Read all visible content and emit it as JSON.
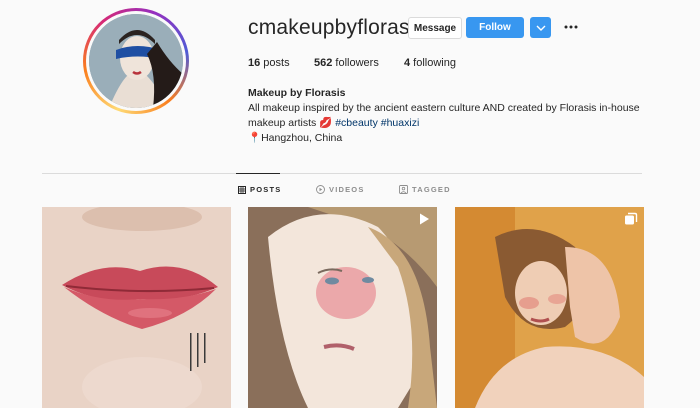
{
  "profile": {
    "username": "cmakeupbyflorasis",
    "avatar_icon": "profile-photo",
    "message_label": "Message",
    "follow_label": "Follow",
    "dropdown_icon": "chevron-down-icon",
    "more_icon": "more-options-icon",
    "accent_color": "#3897f0"
  },
  "stats": {
    "posts_count": "16",
    "posts_label": " posts",
    "followers_count": "562",
    "followers_label": " followers",
    "following_count": "4",
    "following_label": " following"
  },
  "bio": {
    "name": "Makeup by Florasis",
    "line1": "All makeup inspired by the ancient eastern culture AND created by Florasis in-house",
    "line2_text": "makeup artists ",
    "lips_emoji": "💋",
    "hashtag1": "#cbeauty",
    "hashtag2": "#huaxizi",
    "location_pin": "📍",
    "location": "Hangzhou, China"
  },
  "tabs": [
    {
      "label": "POSTS",
      "icon": "grid-icon",
      "active": true
    },
    {
      "label": "VIDEOS",
      "icon": "video-icon",
      "active": false
    },
    {
      "label": "TAGGED",
      "icon": "tagged-icon",
      "active": false
    }
  ],
  "posts": [
    {
      "subject": "red lips close-up",
      "overlay_icon": null
    },
    {
      "subject": "woman with blush makeup",
      "overlay_icon": "play-icon"
    },
    {
      "subject": "woman resting head on hand",
      "overlay_icon": "multiple-images-icon"
    }
  ]
}
